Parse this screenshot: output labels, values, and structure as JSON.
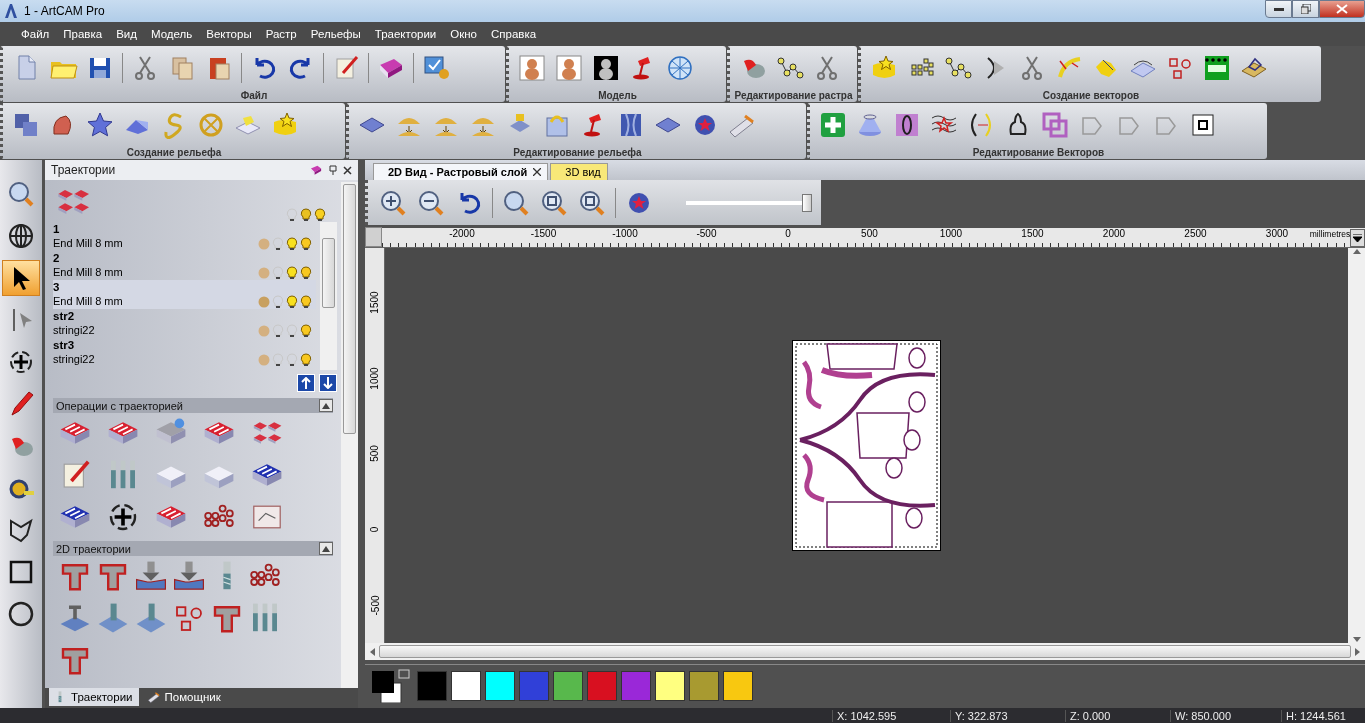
{
  "window": {
    "title": "1 - ArtCAM Pro"
  },
  "menu": [
    "Файл",
    "Правка",
    "Вид",
    "Модель",
    "Векторы",
    "Растр",
    "Рельефы",
    "Траектории",
    "Окно",
    "Справка"
  ],
  "toolbars": [
    {
      "groups": [
        {
          "label": "Файл"
        },
        {
          "label": "Модель"
        },
        {
          "label": "Редактирование растра"
        },
        {
          "label": "Создание векторов"
        }
      ]
    },
    {
      "groups": [
        {
          "label": "Создание рельефа"
        },
        {
          "label": "Редактирование рельефа"
        },
        {
          "label": "Редактирование Векторов"
        }
      ]
    }
  ],
  "left_tools": [
    {
      "selected": false
    },
    {
      "selected": false
    },
    {
      "selected": true
    },
    {
      "selected": false
    },
    {
      "selected": false
    },
    {
      "selected": false
    },
    {
      "selected": false
    },
    {
      "selected": false
    },
    {
      "selected": false
    },
    {
      "selected": false
    },
    {
      "selected": false
    }
  ],
  "panel": {
    "title": "Траектории",
    "toolpaths": [
      {
        "name": "1",
        "tool": "End Mill 8 mm",
        "selected": false,
        "visible": true
      },
      {
        "name": "2",
        "tool": "End Mill 8 mm",
        "selected": false,
        "visible": true
      },
      {
        "name": "3",
        "tool": "End Mill 8 mm",
        "selected": true,
        "visible": true
      },
      {
        "name": "str2",
        "tool": "stringi22",
        "selected": false,
        "visible": false
      },
      {
        "name": "str3",
        "tool": "stringi22",
        "selected": false,
        "visible": false
      }
    ],
    "sections": [
      {
        "title": "Операции с траекторией",
        "expanded": true
      },
      {
        "title": "2D траектории",
        "expanded": true
      }
    ],
    "tabs": [
      {
        "label": "Траектории",
        "selected": true
      },
      {
        "label": "Помощник",
        "selected": false
      }
    ]
  },
  "view": {
    "tabs": [
      {
        "label": "2D Вид - Растровый слой",
        "selected": true
      },
      {
        "label": "3D вид",
        "selected": false
      }
    ],
    "zoom_slider": {
      "level": 1
    },
    "ruler": {
      "x_labels": [
        "-2000",
        "-1500",
        "-1000",
        "-500",
        "0",
        "500",
        "1000",
        "1500",
        "2000",
        "2500",
        "3000"
      ],
      "units": "millimetres",
      "y_labels": [
        "1500",
        "1000",
        "500",
        "0",
        "-500"
      ]
    },
    "palette": {
      "colors": [
        {
          "color": "#000000"
        },
        {
          "color": "#ffffff"
        },
        {
          "color": "#00ffff"
        },
        {
          "color": "#3040d8"
        },
        {
          "color": "#58b84c"
        },
        {
          "color": "#d81020"
        },
        {
          "color": "#9a28d8"
        },
        {
          "color": "#ffff80"
        },
        {
          "color": "#a89a30"
        },
        {
          "color": "#f8c810"
        }
      ]
    }
  },
  "status_bar": [
    "X: 1042.595",
    "Y: 322.873",
    "Z: 0.000",
    "W: 850.000",
    "H: 1244.561"
  ]
}
